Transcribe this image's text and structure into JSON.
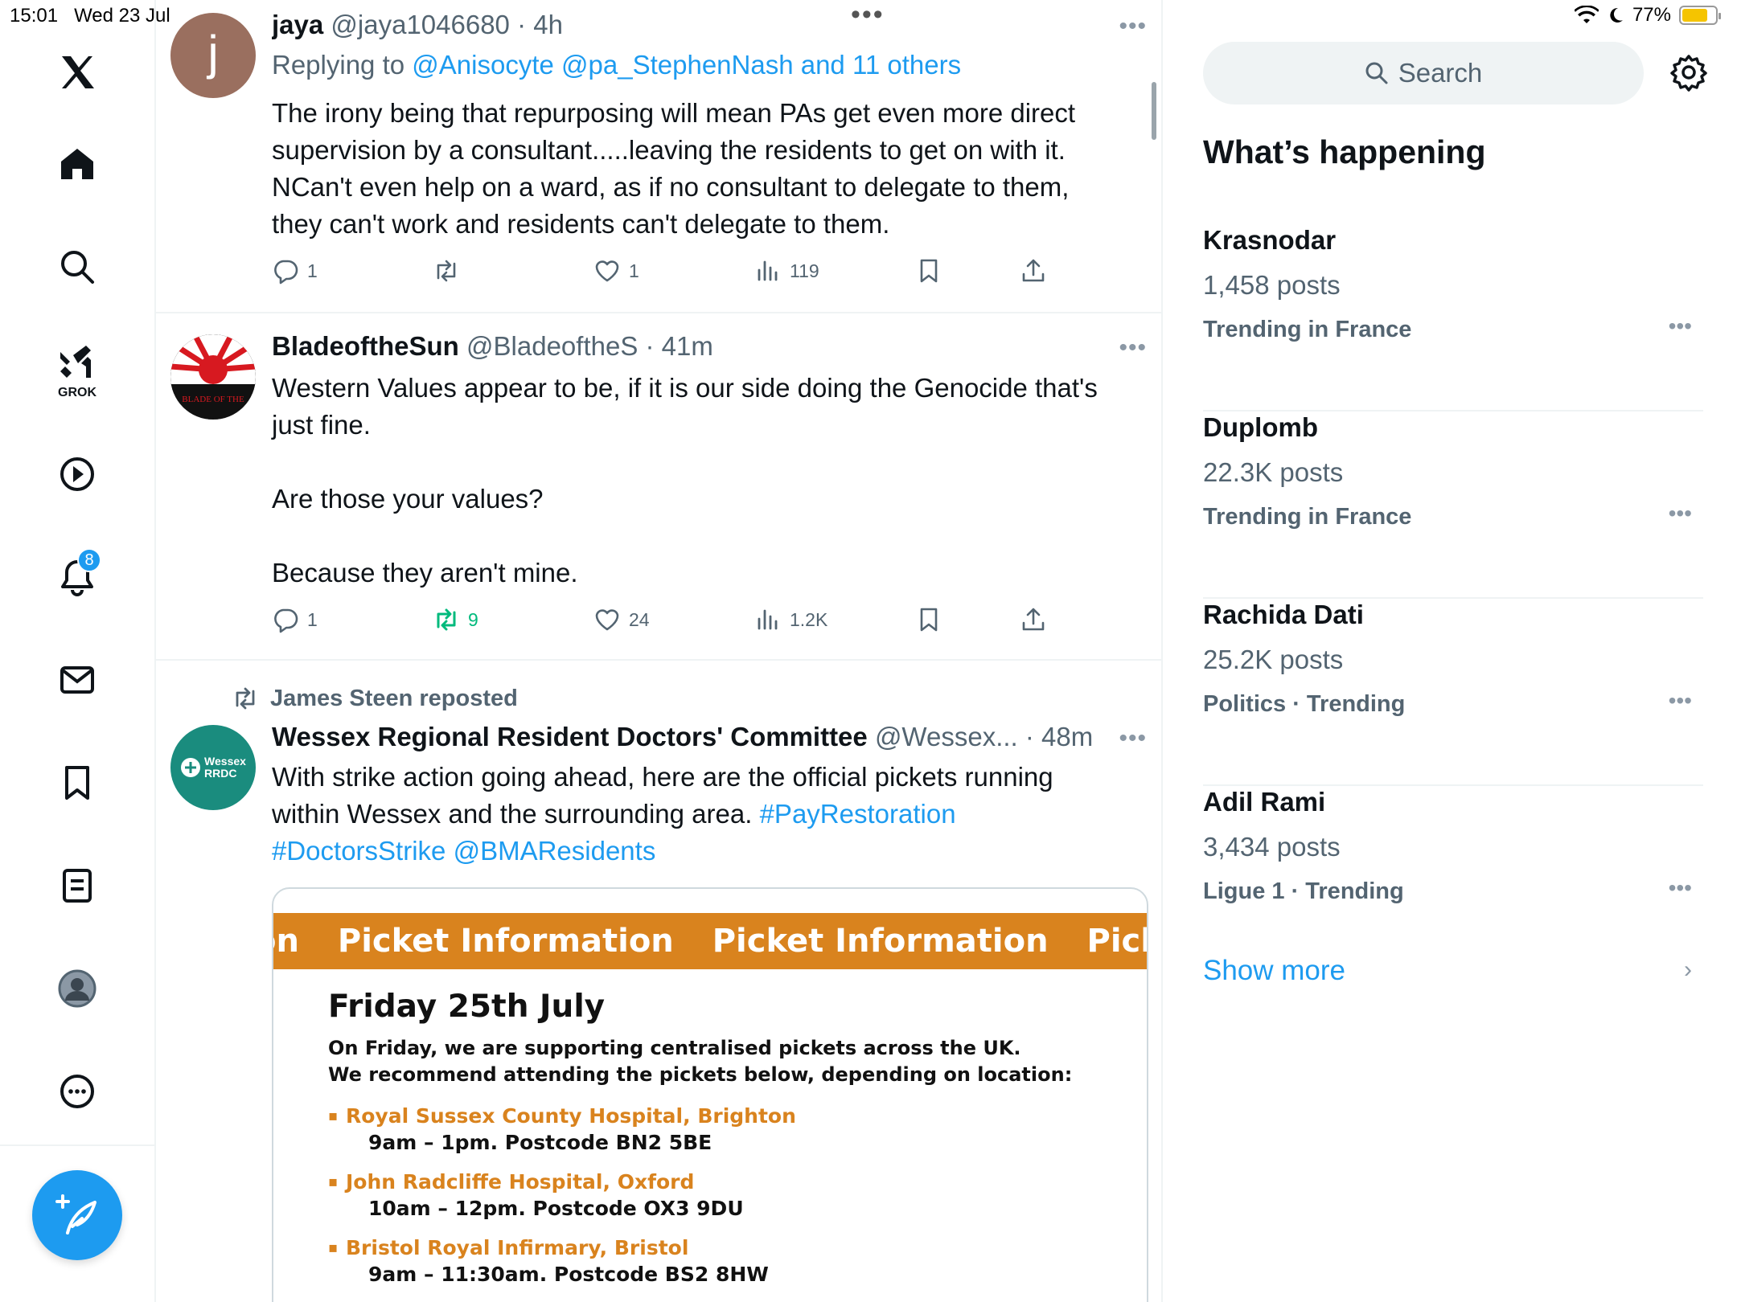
{
  "status_bar": {
    "time": "15:01",
    "date": "Wed 23 Jul",
    "battery": "77%",
    "battery_level": 0.77
  },
  "nav": {
    "grok_label": "GROK",
    "notifications_badge": "8"
  },
  "posts": [
    {
      "name": "jaya",
      "handle": "@jaya1046680",
      "time": "4h",
      "avatar_letter": "j",
      "replying_prefix": "Replying to",
      "replying_to": "@Anisocyte @pa_StephenNash and 11 others",
      "text": "The irony being that repurposing will mean PAs get even more direct supervision by a consultant.....leaving the residents to get on with it. NCan't even help on a ward, as if no consultant to delegate to them, they can't work and residents can't delegate to them.",
      "replies": "1",
      "reposts": "",
      "likes": "1",
      "views": "119"
    },
    {
      "name": "BladeoftheSun",
      "handle": "@BladeoftheS",
      "time": "41m",
      "avatar_text": "BLADE OF THE",
      "text_lines": [
        "Western Values appear to be, if it is our side doing the Genocide that's just fine.",
        "Are those your values?",
        "Because they aren't mine."
      ],
      "replies": "1",
      "reposts": "9",
      "likes": "24",
      "views": "1.2K"
    },
    {
      "reposted_by": "James Steen reposted",
      "name": "Wessex Regional Resident Doctors' Committee",
      "handle": "@Wessex...",
      "time": "48m",
      "avatar_text_1": "Wessex",
      "avatar_text_2": "RRDC",
      "text": "With strike action going ahead, here are the official pickets running within Wessex and the surrounding area.",
      "hashtag_1": "#PayRestoration",
      "hashtag_2": "#DoctorsStrike",
      "mention": "@BMAResidents",
      "card": {
        "banner": [
          "on",
          "Picket Information",
          "Picket Information",
          "Picket Info"
        ],
        "date": "Friday 25th July",
        "intro_1": "On Friday, we are supporting centralised pickets across the UK.",
        "intro_2": "We recommend attending the pickets below, depending on location:",
        "pickets": [
          {
            "location": "Royal Sussex County Hospital, Brighton",
            "time": "9am – 1pm. Postcode BN2 5BE"
          },
          {
            "location": "John Radcliffe Hospital, Oxford",
            "time": "10am – 12pm. Postcode OX3 9DU"
          },
          {
            "location": "Bristol Royal Infirmary, Bristol",
            "time": "9am – 11:30am. Postcode BS2 8HW"
          }
        ]
      }
    }
  ],
  "sidebar": {
    "search_placeholder": "Search",
    "heading": "What’s happening",
    "trends": [
      {
        "title": "Krasnodar",
        "count": "1,458 posts",
        "context": "Trending in France"
      },
      {
        "title": "Duplomb",
        "count": "22.3K posts",
        "context": "Trending in France"
      },
      {
        "title": "Rachida Dati",
        "count": "25.2K posts",
        "context": "Politics · Trending"
      },
      {
        "title": "Adil Rami",
        "count": "3,434 posts",
        "context": "Ligue 1 · Trending"
      }
    ],
    "show_more": "Show more"
  },
  "colors": {
    "accent": "#1d9bf0",
    "repost_green": "#00ba7c",
    "banner_orange": "#d9831e"
  }
}
